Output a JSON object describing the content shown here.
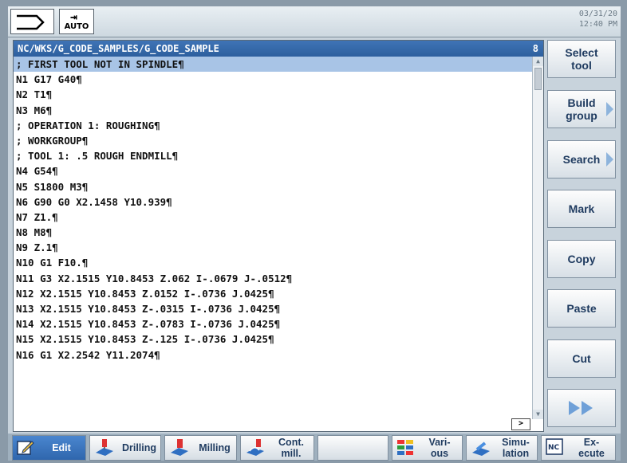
{
  "header": {
    "mode_label": "AUTO",
    "date": "03/31/20",
    "time": "12:40 PM"
  },
  "editor": {
    "path": "NC/WKS/G_CODE_SAMPLES/G_CODE_SAMPLE",
    "number": "8",
    "lines": [
      "; FIRST TOOL NOT IN SPINDLE¶",
      "N1 G17 G40¶",
      "N2 T1¶",
      "N3 M6¶",
      "; OPERATION 1: ROUGHING¶",
      "; WORKGROUP¶",
      "; TOOL 1: .5 ROUGH ENDMILL¶",
      "N4 G54¶",
      "N5 S1800 M3¶",
      "N6 G90 G0 X2.1458 Y10.939¶",
      "N7 Z1.¶",
      "N8 M8¶",
      "N9 Z.1¶",
      "N10 G1 F10.¶",
      "N11 G3 X2.1515 Y10.8453 Z.062 I-.0679 J-.0512¶",
      "N12 X2.1515 Y10.8453 Z.0152 I-.0736 J.0425¶",
      "N13 X2.1515 Y10.8453 Z-.0315 I-.0736 J.0425¶",
      "N14 X2.1515 Y10.8453 Z-.0783 I-.0736 J.0425¶",
      "N15 X2.1515 Y10.8453 Z-.125 I-.0736 J.0425¶",
      "N16 G1 X2.2542 Y11.2074¶"
    ],
    "hscroll_label": ">"
  },
  "vertical_softkeys": [
    {
      "label": "Select\ntool",
      "arrow": false
    },
    {
      "label": "Build\ngroup",
      "arrow": true
    },
    {
      "label": "Search",
      "arrow": true
    },
    {
      "label": "Mark",
      "arrow": false
    },
    {
      "label": "Copy",
      "arrow": false
    },
    {
      "label": "Paste",
      "arrow": false
    },
    {
      "label": "Cut",
      "arrow": false
    }
  ],
  "horizontal_softkeys": [
    {
      "label": "Edit",
      "icon": "edit-icon",
      "active": true
    },
    {
      "label": "Drilling",
      "icon": "drilling-icon",
      "active": false
    },
    {
      "label": "Milling",
      "icon": "milling-icon",
      "active": false
    },
    {
      "label": "Cont.\nmill.",
      "icon": "contour-milling-icon",
      "active": false
    },
    {
      "label": "",
      "icon": "",
      "active": false
    },
    {
      "label": "Vari-\nous",
      "icon": "various-icon",
      "active": false
    },
    {
      "label": "Simu-\nlation",
      "icon": "simulation-icon",
      "active": false
    },
    {
      "label": "Ex-\necute",
      "icon": "nc-execute-icon",
      "active": false
    }
  ],
  "colors": {
    "path_bar": "#2d5f9e",
    "selection": "#a8c4e6",
    "softkey_text": "#1e3a5f",
    "active_softkey": "#2f66ad"
  }
}
